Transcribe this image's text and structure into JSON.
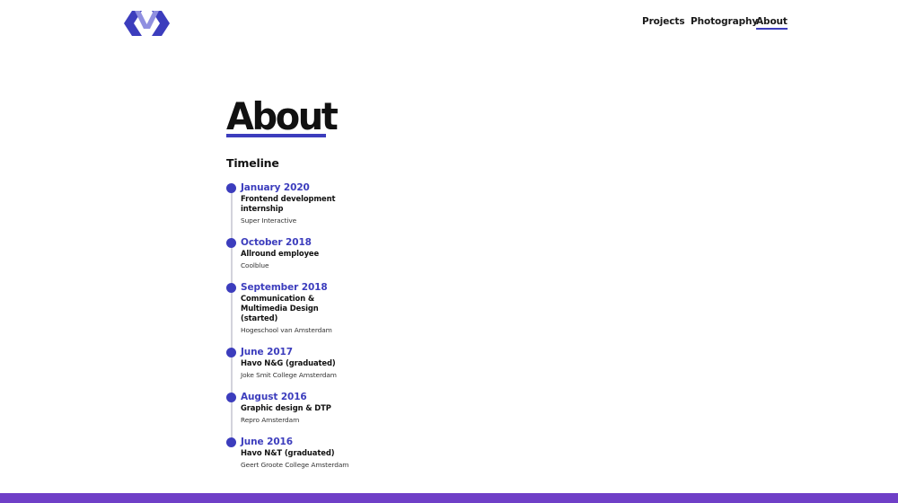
{
  "colors": {
    "accent": "#3c3dbd",
    "footer": "#6f3fc7",
    "logo_light": "#8f8fe0",
    "text": "#111111"
  },
  "logo": {
    "name": "logo-icon"
  },
  "nav": {
    "items": [
      {
        "label": "Projects"
      },
      {
        "label": "Photography"
      },
      {
        "label": "About",
        "active": true
      }
    ]
  },
  "page": {
    "title": "About"
  },
  "timeline": {
    "heading": "Timeline",
    "items": [
      {
        "date": "January 2020",
        "title": "Frontend development internship",
        "org": "Super Interactive"
      },
      {
        "date": "October 2018",
        "title": "Allround employee",
        "org": "Coolblue"
      },
      {
        "date": "September 2018",
        "title": "Communication & Multimedia Design (started)",
        "org": "Hogeschool van Amsterdam"
      },
      {
        "date": "June 2017",
        "title": "Havo N&G (graduated)",
        "org": "Joke Smit College Amsterdam"
      },
      {
        "date": "August 2016",
        "title": "Graphic design & DTP",
        "org": "Repro Amsterdam"
      },
      {
        "date": "June 2016",
        "title": "Havo N&T (graduated)",
        "org": "Geert Groote College Amsterdam"
      }
    ]
  }
}
